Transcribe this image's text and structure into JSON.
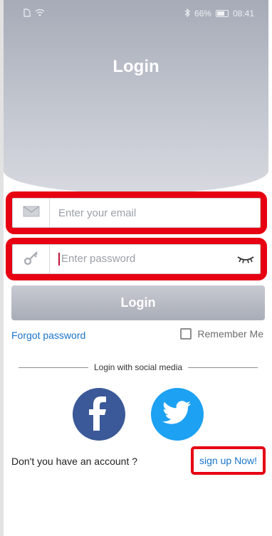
{
  "status_bar": {
    "battery": "66%",
    "time": "08:41"
  },
  "header": {
    "title": "Login"
  },
  "email_field": {
    "placeholder": "Enter your email",
    "icon": "envelope-icon"
  },
  "password_field": {
    "placeholder": "Enter password",
    "icon": "key-icon",
    "toggle_icon": "eye-hidden-icon"
  },
  "login_button": {
    "label": "Login"
  },
  "forgot_password": {
    "label": "Forgot password"
  },
  "remember_me": {
    "label": "Remember Me",
    "checked": false
  },
  "social": {
    "divider_label": "Login with social media",
    "providers": [
      "facebook",
      "twitter"
    ]
  },
  "signup": {
    "prompt": "Don't you have an account ?",
    "link": "sign up Now!"
  },
  "colors": {
    "highlight": "#e60012",
    "link": "#1b74c8",
    "facebook": "#3b5998",
    "twitter": "#1da1f2"
  }
}
